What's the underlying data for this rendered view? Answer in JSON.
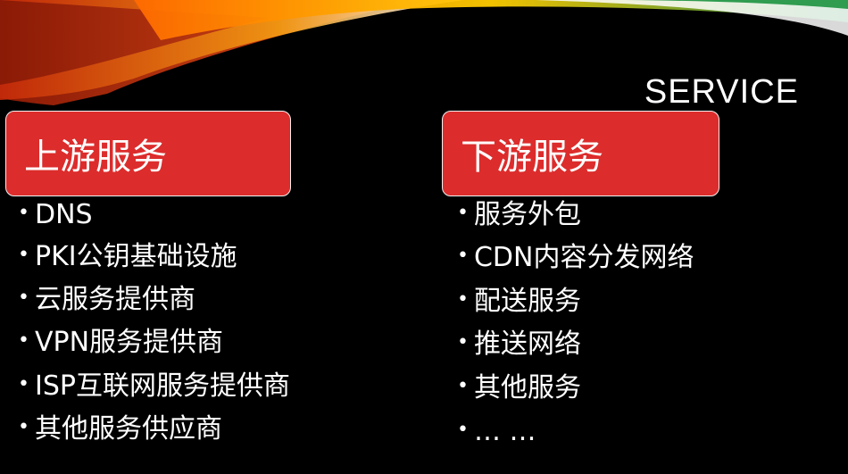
{
  "slide": {
    "title": "SERVICE",
    "upstream": {
      "heading": "上游服务",
      "items": [
        "DNS",
        "PKI公钥基础设施",
        "云服务提供商",
        "VPN服务提供商",
        "ISP互联网服务提供商",
        "其他服务供应商"
      ]
    },
    "downstream": {
      "heading": "下游服务",
      "items": [
        "服务外包",
        "CDN内容分发网络",
        "配送服务",
        "推送网络",
        "其他服务",
        "… …"
      ]
    },
    "bullet": "•",
    "colors": {
      "background": "#000000",
      "box": "#dc2c2c",
      "text": "#ffffff"
    }
  }
}
